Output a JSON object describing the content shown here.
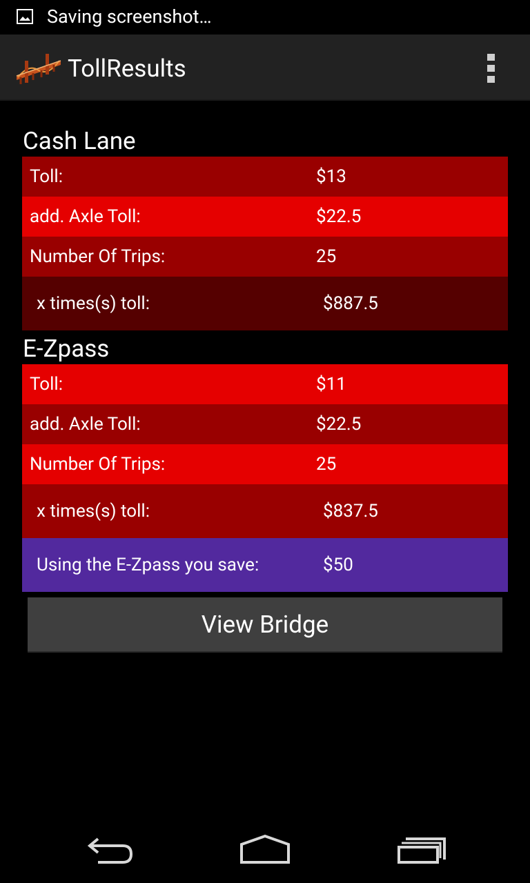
{
  "status_bar": {
    "notification_icon": "image-icon",
    "text": "Saving screenshot…"
  },
  "action_bar": {
    "app_icon": "bridge-icon",
    "title": "TollResults",
    "overflow_icon": "overflow-menu-icon"
  },
  "cash_lane": {
    "title": "Cash Lane",
    "rows": [
      {
        "label": "Toll:",
        "value": "$13"
      },
      {
        "label": "add. Axle Toll:",
        "value": "$22.5"
      },
      {
        "label": "Number Of Trips:",
        "value": "25"
      },
      {
        "label": "x times(s) toll:",
        "value": "$887.5"
      }
    ]
  },
  "ezpass": {
    "title": "E-Zpass",
    "rows": [
      {
        "label": "Toll:",
        "value": "$11"
      },
      {
        "label": "add. Axle Toll:",
        "value": "$22.5"
      },
      {
        "label": "Number Of Trips:",
        "value": "25"
      },
      {
        "label": "x times(s) toll:",
        "value": "$837.5"
      },
      {
        "label": "Using the E-Zpass you save:",
        "value": "$50"
      }
    ]
  },
  "button": {
    "label": "View Bridge"
  },
  "nav_bar": {
    "back_icon": "back-icon",
    "home_icon": "home-icon",
    "recents_icon": "recent-apps-icon"
  },
  "colors": {
    "row_dark": "#990000",
    "row_red": "#e50000",
    "row_deep": "#550000",
    "row_purple": "#52299e",
    "action_bar": "#222222",
    "button": "#3f3f3f"
  }
}
